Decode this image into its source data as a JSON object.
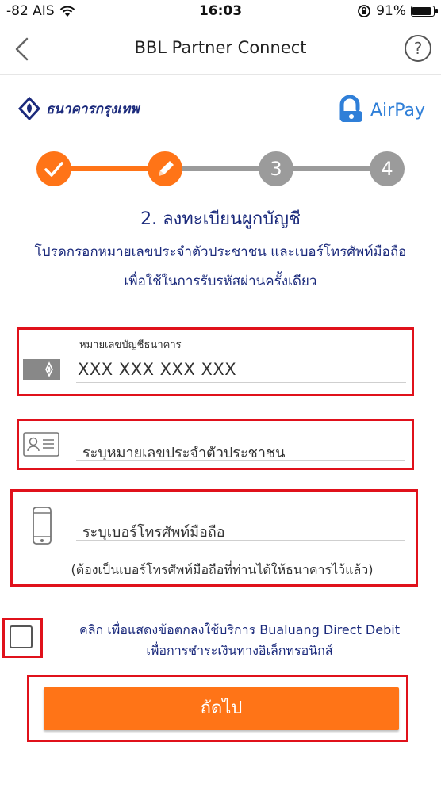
{
  "status_bar": {
    "carrier": "-82 AIS",
    "time": "16:03",
    "battery": "91%",
    "battery_level": 0.91,
    "icons": [
      "wifi-icon",
      "rotation-lock-icon",
      "battery-icon"
    ]
  },
  "navbar": {
    "title": "BBL Partner Connect",
    "help": "?",
    "icons": [
      "back-chevron-icon",
      "help-circle-icon"
    ]
  },
  "logos": {
    "bank_name": "ธนาคารกรุงเทพ",
    "partner_name": "AirPay"
  },
  "stepper": {
    "steps": [
      {
        "number": "1",
        "state": "done",
        "icon": "check-icon"
      },
      {
        "number": "2",
        "state": "current",
        "icon": "pencil-icon"
      },
      {
        "number": "3",
        "state": "todo"
      },
      {
        "number": "4",
        "state": "todo"
      }
    ],
    "colors": {
      "active": "#ff7417",
      "inactive": "#9b9b9b"
    }
  },
  "step_heading": "2. ลงทะเบียนผูกบัญชี",
  "instructions": {
    "line1": "โปรดกรอกหมายเลขประจำตัวประชาชน และเบอร์โทรศัพท์มือถือ",
    "line2": "เพื่อใช้ในการรับรหัสผ่านครั้งเดียว"
  },
  "form": {
    "account": {
      "label": "หมายเลขบัญชีธนาคาร",
      "value": "XXX XXX XXX XXX",
      "icon": "bank-card-icon"
    },
    "citizen_id": {
      "placeholder": "ระบุหมายเลขประจำตัวประชาชน",
      "icon": "id-card-icon"
    },
    "mobile": {
      "placeholder": "ระบุเบอร์โทรศัพท์มือถือ",
      "note": "(ต้องเป็นเบอร์โทรศัพท์มือถือที่ท่านได้ให้ธนาคารไว้แล้ว)",
      "icon": "mobile-phone-icon"
    }
  },
  "consent": {
    "line1": "คลิก เพื่อแสดงข้อตกลงใช้บริการ Bualuang Direct Debit",
    "line2": "เพื่อการชำระเงินทางอิเล็กทรอนิกส์",
    "checked": false
  },
  "next_button": "ถัดไป",
  "colors": {
    "brand_blue": "#1b2a7c",
    "accent_orange": "#ff7417",
    "highlight_red": "#e0111b",
    "airpay_blue": "#2f7fd8"
  }
}
